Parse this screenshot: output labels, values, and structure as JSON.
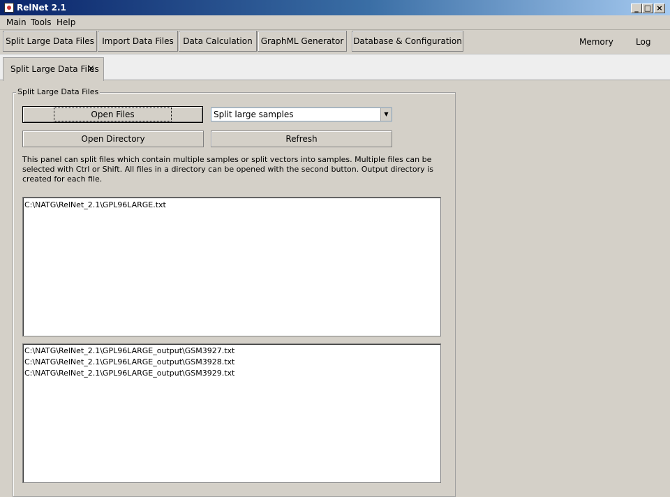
{
  "window": {
    "title": "RelNet 2.1",
    "icon": "java-icon"
  },
  "menu": [
    "Main",
    "Tools",
    "Help"
  ],
  "toolbar": {
    "buttons": [
      "Split Large Data Files",
      "Import Data Files",
      "Data Calculation",
      "GraphML Generator",
      "Database & Configuration"
    ],
    "links": [
      "Memory",
      "Log"
    ]
  },
  "tab": {
    "label": "Split Large Data Files",
    "close": "×"
  },
  "panel": {
    "title": "Split Large Data Files",
    "open_files": "Open Files",
    "open_directory": "Open Directory",
    "refresh": "Refresh",
    "mode_select": "Split large samples",
    "description": [
      "This panel can split files which contain multiple samples or split vectors into samples. Multiple files can be",
      "selected with Ctrl or Shift. All files in a directory can be opened with the second button. Output directory is",
      "created for each file."
    ],
    "input_files": [
      "C:\\NATG\\RelNet_2.1\\GPL96LARGE.txt"
    ],
    "output_files": [
      "C:\\NATG\\RelNet_2.1\\GPL96LARGE_output\\GSM3927.txt",
      "C:\\NATG\\RelNet_2.1\\GPL96LARGE_output\\GSM3928.txt",
      "C:\\NATG\\RelNet_2.1\\GPL96LARGE_output\\GSM3929.txt"
    ]
  }
}
